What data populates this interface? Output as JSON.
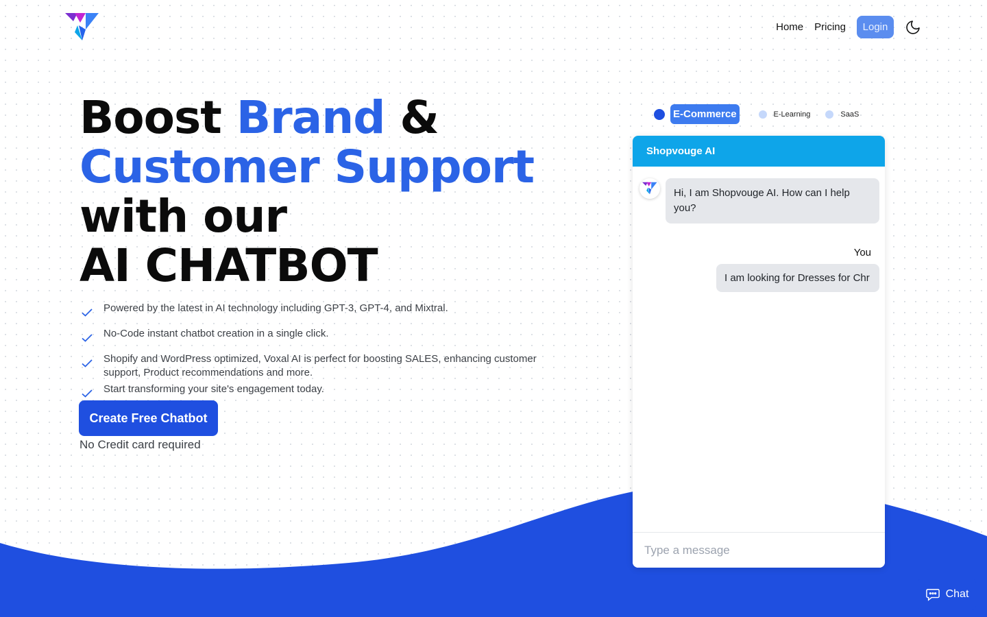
{
  "nav": {
    "home": "Home",
    "pricing": "Pricing",
    "login": "Login"
  },
  "hero": {
    "line1_a": "Boost ",
    "line1_b": "Brand",
    "line1_c": " &",
    "line2": "Customer Support",
    "line3": "with our",
    "line4": "AI CHATBOT"
  },
  "features": [
    "Powered by the latest in AI technology including GPT-3, GPT-4, and Mixtral.",
    "No-Code instant chatbot creation in a single click.",
    "Shopify and WordPress optimized, Voxal AI is perfect for boosting SALES, enhancing customer support, Product recommendations and more.",
    "Start transforming your site's engagement today."
  ],
  "cta": {
    "label": "Create Free Chatbot",
    "note": "No Credit card required"
  },
  "tabs": [
    {
      "label": "E-Commerce",
      "active": true
    },
    {
      "label": "E-Learning",
      "active": false
    },
    {
      "label": "SaaS",
      "active": false
    }
  ],
  "chat": {
    "title": "Shopvouge AI",
    "bot_message": "Hi, I am Shopvouge AI. How can I help you?",
    "user_label": "You",
    "user_message": "I am looking for Dresses for Chr",
    "input_placeholder": "Type a message"
  },
  "float_chat": {
    "label": "Chat",
    "icon": "chat-bubbles-icon"
  },
  "colors": {
    "brand_blue": "#1f4fe0",
    "accent_blue": "#2b63e6",
    "chat_header": "#0ea5e9",
    "login_bg": "#5b8def"
  }
}
